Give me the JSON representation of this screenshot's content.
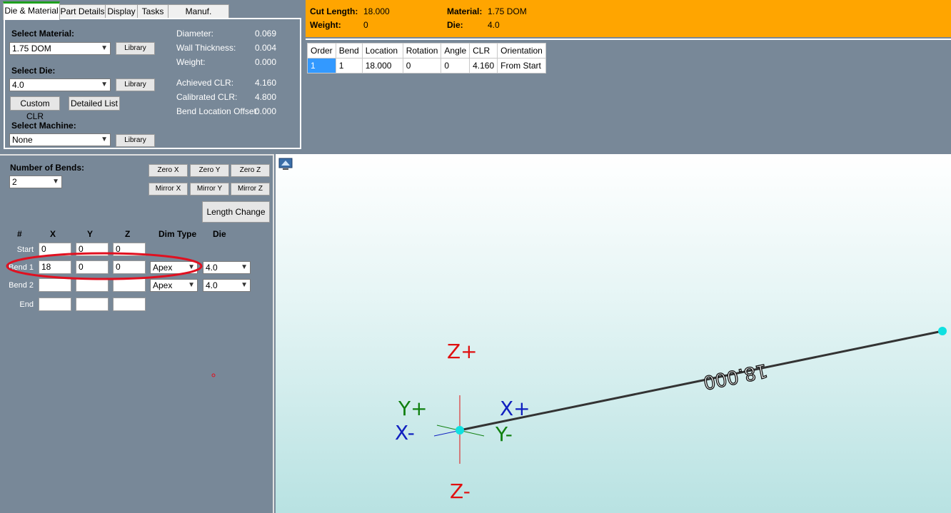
{
  "tabs": [
    "Die & Material",
    "Part Details",
    "Display",
    "Tasks",
    "Manuf. Warning"
  ],
  "material_panel": {
    "select_material_label": "Select Material:",
    "material_value": "1.75 DOM",
    "select_die_label": "Select Die:",
    "die_value": "4.0",
    "select_machine_label": "Select Machine:",
    "machine_value": "None",
    "library_label": "Library",
    "custom_clr_label": "Custom CLR",
    "detailed_list_label": "Detailed List",
    "info": [
      {
        "label": "Diameter:",
        "value": "0.069"
      },
      {
        "label": "Wall Thickness:",
        "value": "0.004"
      },
      {
        "label": "Weight:",
        "value": "0.000"
      },
      {
        "label": "Achieved CLR:",
        "value": "4.160"
      },
      {
        "label": "Calibrated CLR:",
        "value": "4.800"
      },
      {
        "label": "Bend Location Offset:",
        "value": "0.000"
      }
    ]
  },
  "summary": {
    "cut_length_label": "Cut Length:",
    "cut_length_value": "18.000",
    "weight_label": "Weight:",
    "weight_value": "0",
    "material_label": "Material:",
    "material_value": "1.75 DOM",
    "die_label": "Die:",
    "die_value": "4.0"
  },
  "bend_table": {
    "headers": [
      "Order",
      "Bend",
      "Location",
      "Rotation",
      "Angle",
      "CLR",
      "Orientation"
    ],
    "rows": [
      [
        "1",
        "1",
        "18.000",
        "0",
        "0",
        "4.160",
        "From Start"
      ]
    ]
  },
  "bends_panel": {
    "num_bends_label": "Number of Bends:",
    "num_bends_value": "2",
    "zero_x": "Zero X",
    "zero_y": "Zero Y",
    "zero_z": "Zero Z",
    "mirror_x": "Mirror X",
    "mirror_y": "Mirror Y",
    "mirror_z": "Mirror Z",
    "length_change": "Length Change",
    "col_headers": [
      "#",
      "X",
      "Y",
      "Z",
      "Dim Type",
      "Die"
    ],
    "rows": [
      {
        "label": "Start",
        "x": "0",
        "y": "0",
        "z": "0",
        "dim": "",
        "die": ""
      },
      {
        "label": "Bend 1",
        "x": "18",
        "y": "0",
        "z": "0",
        "dim": "Apex",
        "die": "4.0"
      },
      {
        "label": "Bend 2",
        "x": "",
        "y": "",
        "z": "",
        "dim": "Apex",
        "die": "4.0"
      },
      {
        "label": "End",
        "x": "",
        "y": "",
        "z": "",
        "dim": "",
        "die": ""
      }
    ]
  },
  "viewport": {
    "axis_labels": {
      "z_plus": "Z+",
      "z_minus": "Z-",
      "x_plus": "X+",
      "x_minus": "X-",
      "y_plus": "Y+",
      "y_minus": "Y-"
    },
    "tube_label": "18.000",
    "colors": {
      "z_axis": "#e01010",
      "x_axis": "#1020c0",
      "y_axis": "#108010",
      "endpoint": "#10e0e0",
      "highlight": "#e01020"
    }
  }
}
